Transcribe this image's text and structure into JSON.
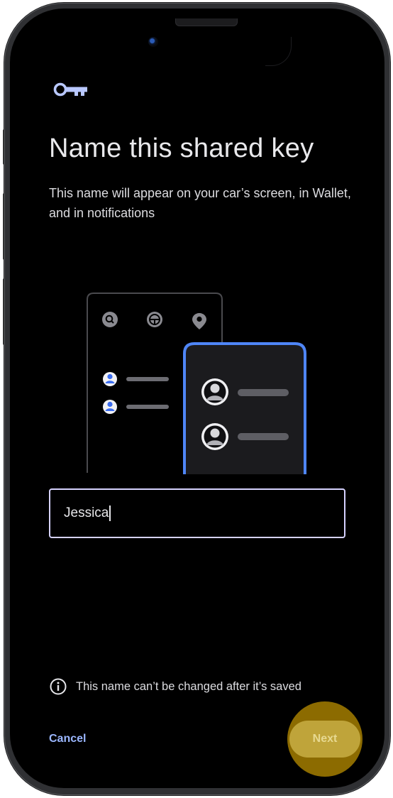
{
  "header": {
    "icon": "key-icon"
  },
  "main": {
    "title": "Name this shared key",
    "subtitle": "This name will appear on your car’s screen, in Wallet, and in notifications",
    "illustration": {
      "car_display_icons": [
        "search-icon",
        "steering-wheel-icon",
        "location-pin-icon"
      ],
      "car_display_rows": [
        "person-icon",
        "person-icon"
      ],
      "phone_rows": [
        "avatar",
        "avatar"
      ]
    }
  },
  "name_field": {
    "value": "Jessica"
  },
  "info": {
    "icon": "info-icon",
    "text": "This name can’t be changed after it’s saved"
  },
  "actions": {
    "cancel_label": "Cancel",
    "next_label": "Next"
  },
  "colors": {
    "background": "#000000",
    "accent_blue": "#4f86f7",
    "link_blue": "#9bb7ff",
    "field_border": "#d6d2ff",
    "highlight_gold": "#9f7a00",
    "next_fill": "#bfa43a"
  }
}
